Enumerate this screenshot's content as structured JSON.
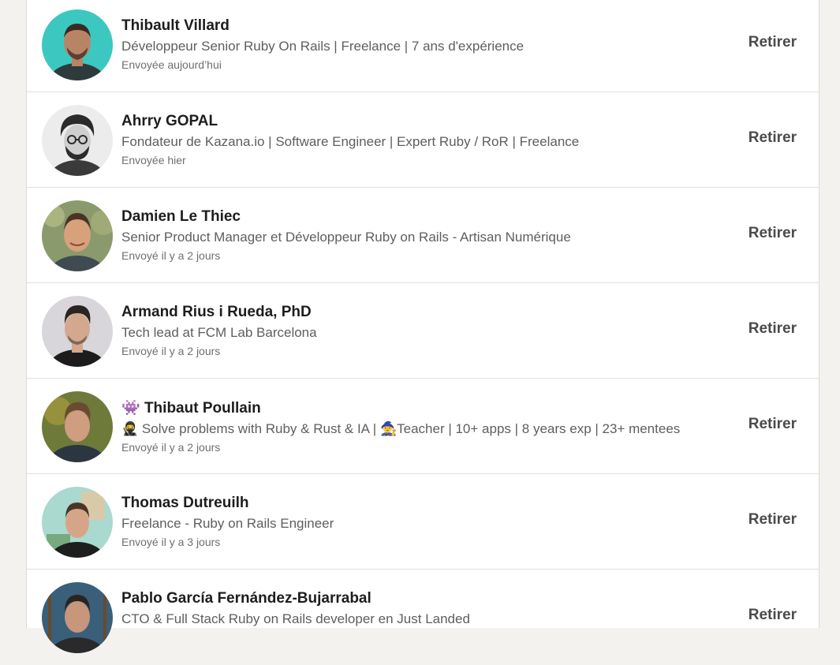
{
  "invitations": [
    {
      "name": "Thibault Villard",
      "headline": "Développeur Senior Ruby On Rails | Freelance | 7 ans d'expérience",
      "sent": "Envoyée aujourd’hui",
      "action": "Retirer",
      "avatar_bg": "#3cc8c0",
      "avatar_skin": "#b98466",
      "avatar_hair": "#3a2a22",
      "avatar_shirt": "#2f3a3c"
    },
    {
      "name": "Ahrry GOPAL",
      "headline": "Fondateur de Kazana.io | Software Engineer | Expert Ruby / RoR | Freelance",
      "sent": "Envoyée hier",
      "action": "Retirer",
      "avatar_bg": "#ececec",
      "avatar_skin": "#cfcfcf",
      "avatar_hair": "#2b2b2b",
      "avatar_shirt": "#3a3a3a"
    },
    {
      "name": "Damien Le Thiec",
      "headline": "Senior Product Manager et Développeur Ruby on Rails - Artisan Numérique",
      "sent": "Envoyé il y a 2 jours",
      "action": "Retirer",
      "avatar_bg": "#8a9a6c",
      "avatar_skin": "#d7a17c",
      "avatar_hair": "#4a3324",
      "avatar_shirt": "#3f4a52"
    },
    {
      "name": "Armand Rius i Rueda, PhD",
      "headline": "Tech lead at FCM Lab Barcelona",
      "sent": "Envoyé il y a 2 jours",
      "action": "Retirer",
      "avatar_bg": "#d8d6da",
      "avatar_skin": "#d3a88e",
      "avatar_hair": "#2c2420",
      "avatar_shirt": "#1c1c1c"
    },
    {
      "name_prefix": "👾",
      "name": "Thibaut Poullain",
      "headline_prefix": "🥷",
      "headline": "Solve problems with Ruby & Rust & IA |",
      "headline_icon": "🧙",
      "headline_rest": "Teacher | 10+ apps | 8 years exp | 23+ mentees",
      "sent": "Envoyé il y a 2 jours",
      "action": "Retirer",
      "avatar_bg": "#6e7a3a",
      "avatar_skin": "#cf9d80",
      "avatar_hair": "#6a4a30",
      "avatar_shirt": "#2c3640"
    },
    {
      "name": "Thomas Dutreuilh",
      "headline": "Freelance - Ruby on Rails Engineer",
      "sent": "Envoyé il y a 3 jours",
      "action": "Retirer",
      "avatar_bg": "#a9d9cf",
      "avatar_skin": "#d6a588",
      "avatar_hair": "#4b3528",
      "avatar_shirt": "#1e1e1e"
    },
    {
      "name": "Pablo García Fernández-Bujarrabal",
      "headline": "CTO & Full Stack Ruby on Rails developer en Just Landed",
      "sent": "",
      "action": "Retirer",
      "avatar_bg": "#3a5f7a",
      "avatar_skin": "#c8967a",
      "avatar_hair": "#2a2420",
      "avatar_shirt": "#2a2a2a"
    }
  ]
}
